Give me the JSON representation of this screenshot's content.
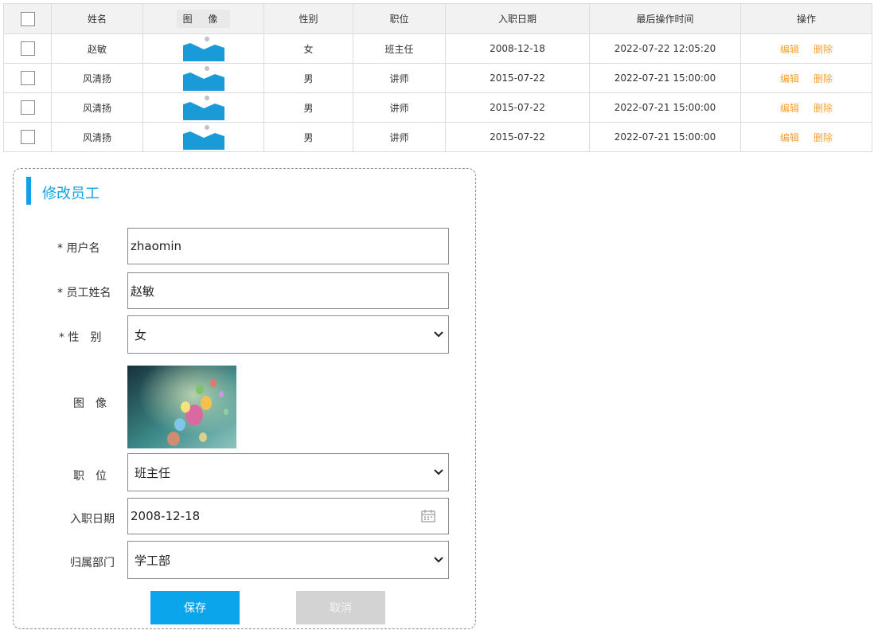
{
  "table": {
    "headers": [
      "姓名",
      "图 像",
      "性别",
      "职位",
      "入职日期",
      "最后操作时间",
      "操作"
    ],
    "rows": [
      {
        "name": "赵敏",
        "gender": "女",
        "position": "班主任",
        "entry_date": "2008-12-18",
        "last_op": "2022-07-22 12:05:20",
        "edit": "编辑",
        "delete": "删除"
      },
      {
        "name": "风清扬",
        "gender": "男",
        "position": "讲师",
        "entry_date": "2015-07-22",
        "last_op": "2022-07-21 15:00:00",
        "edit": "编辑",
        "delete": "删除"
      },
      {
        "name": "风清扬",
        "gender": "男",
        "position": "讲师",
        "entry_date": "2015-07-22",
        "last_op": "2022-07-21 15:00:00",
        "edit": "编辑",
        "delete": "删除"
      },
      {
        "name": "风清扬",
        "gender": "男",
        "position": "讲师",
        "entry_date": "2015-07-22",
        "last_op": "2022-07-21 15:00:00",
        "edit": "编辑",
        "delete": "删除"
      }
    ]
  },
  "form": {
    "title": "修改员工",
    "username_label": "* 用户名",
    "username_value": "zhaomin",
    "realname_label": "* 员工姓名",
    "realname_value": "赵敏",
    "gender_label": "* 性　别",
    "gender_value": "女",
    "image_label": "图　像",
    "position_label": "职　位",
    "position_value": "班主任",
    "entry_date_label": "入职日期",
    "entry_date_value": "2008-12-18",
    "dept_label": "归属部门",
    "dept_value": "学工部",
    "save_label": "保存",
    "cancel_label": "取消"
  },
  "colors": {
    "accent": "#11a1e4",
    "link": "#f5a033",
    "save_button": "#0aa5ea",
    "cancel_button": "#d3d3d3",
    "header_bg": "#f2f2f2"
  },
  "icons": [
    "image-placeholder-icon",
    "chevron-down-icon",
    "calendar-icon"
  ]
}
